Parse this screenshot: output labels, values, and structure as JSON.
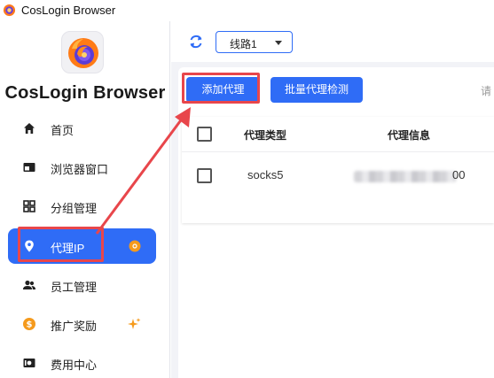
{
  "window": {
    "title": "CosLogin Browser"
  },
  "sidebar": {
    "brand": "CosLogin Browser",
    "items": [
      {
        "label": "首页",
        "icon": "home-icon",
        "active": false
      },
      {
        "label": "浏览器窗口",
        "icon": "browser-window-icon",
        "active": false
      },
      {
        "label": "分组管理",
        "icon": "grid-icon",
        "active": false
      },
      {
        "label": "代理IP",
        "icon": "location-pin-icon",
        "active": true,
        "badge": "settings-badge-icon"
      },
      {
        "label": "员工管理",
        "icon": "people-icon",
        "active": false
      },
      {
        "label": "推广奖励",
        "icon": "dollar-coin-icon",
        "active": false,
        "badge": "sparkle-icon"
      },
      {
        "label": "费用中心",
        "icon": "billing-icon",
        "active": false
      }
    ]
  },
  "toolbar": {
    "route_value": "线路1"
  },
  "actions": {
    "add_label": "添加代理",
    "batch_label": "批量代理检测",
    "search_placeholder": "请"
  },
  "table": {
    "headers": [
      "代理类型",
      "代理信息"
    ],
    "rows": [
      {
        "type": "socks5",
        "info_visible_tail": "00"
      }
    ]
  },
  "colors": {
    "accent": "#2f6cf6",
    "highlight": "#e8464b",
    "badge_orange": "#f59a1c"
  }
}
